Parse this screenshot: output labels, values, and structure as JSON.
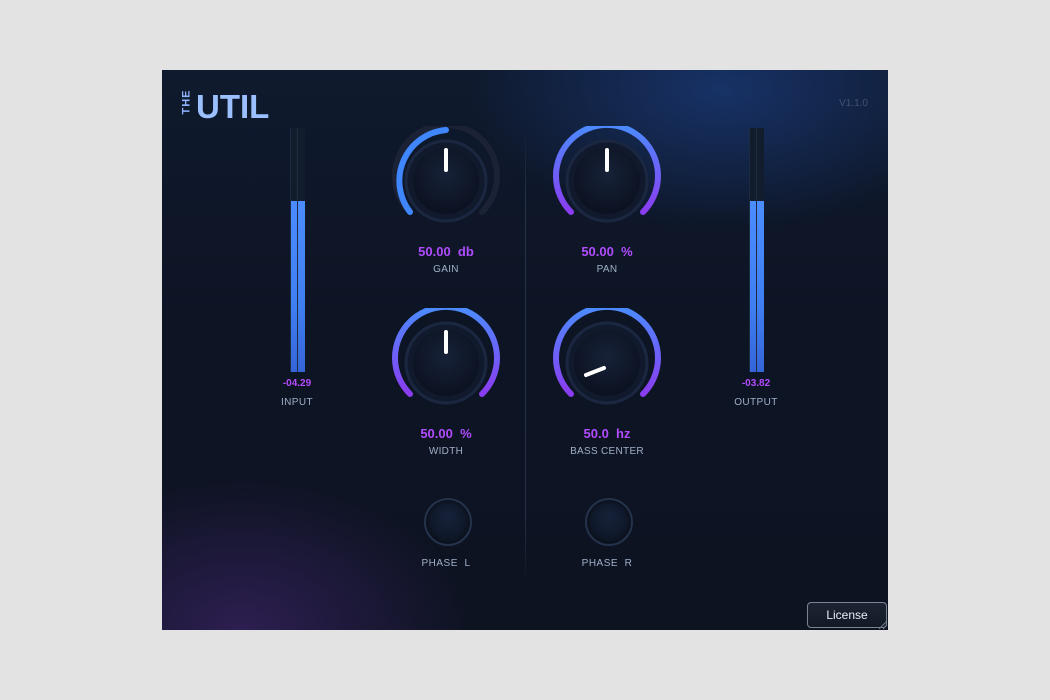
{
  "header": {
    "logo_small": "THE",
    "logo_main": "UTIL",
    "version": "V1.1.0"
  },
  "meters": {
    "input": {
      "value": "-04.29",
      "label": "INPUT",
      "level": 0.7
    },
    "output": {
      "value": "-03.82",
      "label": "OUTPUT",
      "level": 0.7
    }
  },
  "knobs": {
    "gain": {
      "value": "50.00  db",
      "label": "GAIN"
    },
    "pan": {
      "value": "50.00  %",
      "label": "PAN"
    },
    "width": {
      "value": "50.00  %",
      "label": "WIDTH"
    },
    "bass_center": {
      "value": "50.0  hz",
      "label": "BASS CENTER"
    }
  },
  "phase": {
    "left_label": "PHASE  L",
    "right_label": "PHASE  R"
  },
  "footer": {
    "license_label": "License"
  },
  "colors": {
    "accent_value": "#b14cff",
    "arc_blue": "#3f86ff",
    "arc_purple": "#8a3cf0"
  }
}
